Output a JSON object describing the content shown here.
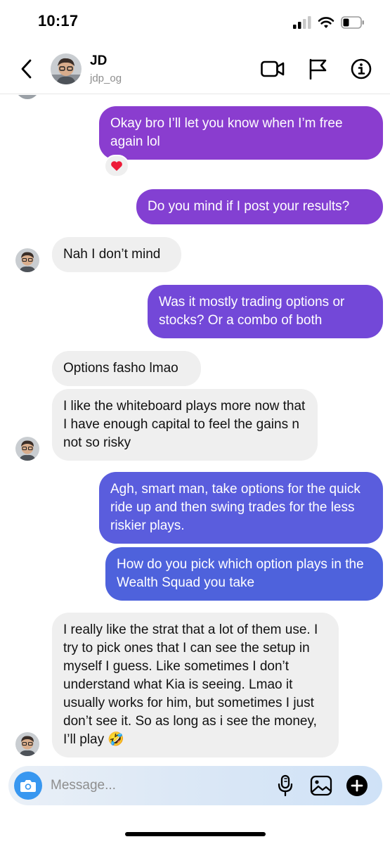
{
  "status_bar": {
    "time": "10:17"
  },
  "header": {
    "name": "JD",
    "handle": "jdp_og"
  },
  "messages": [
    {
      "id": "m1",
      "from": "me",
      "text": "Okay bro I’ll let you know when I’m free again lol",
      "reaction": "heart"
    },
    {
      "id": "m2",
      "from": "me",
      "text": "Do you mind if I post your results?"
    },
    {
      "id": "m3",
      "from": "them",
      "text": "Nah I don’t mind"
    },
    {
      "id": "m4",
      "from": "me",
      "text": "Was it mostly trading options or stocks? Or a combo of both"
    },
    {
      "id": "m5",
      "from": "them",
      "text": "Options fasho lmao"
    },
    {
      "id": "m6",
      "from": "them",
      "text": "I like the whiteboard plays more now that I have enough capital to feel the gains n not so risky"
    },
    {
      "id": "m7",
      "from": "me",
      "text": "Agh, smart man, take options for the quick ride up and then swing trades for the less riskier plays."
    },
    {
      "id": "m8",
      "from": "me",
      "text": "How do you pick which option plays in the Wealth Squad you take"
    },
    {
      "id": "m9",
      "from": "them",
      "text": "I really like the strat that a lot of them use. I try to pick ones that I can see the setup in myself I guess. Like sometimes I don’t understand what Kia is seeing. Lmao it usually works for him, but sometimes I just don’t see it. So as long as i see the money, I’ll play 🤣"
    }
  ],
  "composer": {
    "placeholder": "Message..."
  },
  "colors": {
    "incoming_bubble": "#efefef",
    "outgoing_top": "#8a3dcf",
    "outgoing_bottom": "#4e62dc",
    "accent_blue": "#3897f0"
  }
}
